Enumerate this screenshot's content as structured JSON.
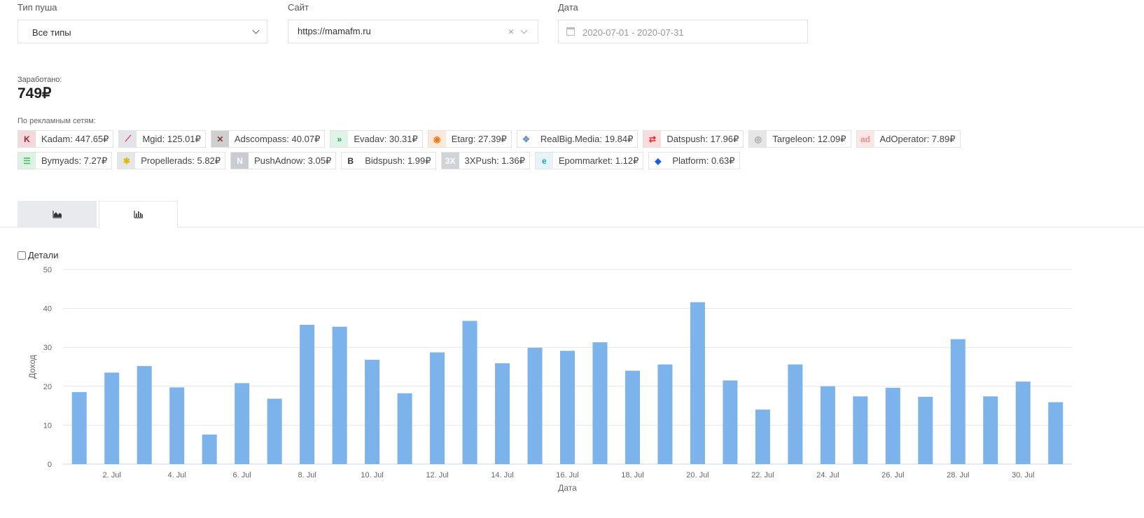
{
  "filters": {
    "push_type": {
      "label": "Тип пуша",
      "value": "Все типы"
    },
    "site": {
      "label": "Сайт",
      "value": "https://mamafm.ru",
      "clear": "×"
    },
    "date": {
      "label": "Дата",
      "placeholder": "2020-07-01 - 2020-07-31"
    }
  },
  "earned": {
    "label": "Заработано:",
    "value": "749₽"
  },
  "networks": {
    "label": "По рекламным сетям:",
    "items": [
      {
        "text": "Kadam: 447.65₽",
        "icon": "K",
        "color": "#b31b34",
        "bg": "#f3d9dd"
      },
      {
        "text": "Mgid: 125.01₽",
        "icon": "⟋",
        "color": "#e8242e",
        "bg": "#e3e3ec"
      },
      {
        "text": "Adscompass: 40.07₽",
        "icon": "✕",
        "color": "#7a3a3a",
        "bg": "#cfcfcf"
      },
      {
        "text": "Evadav: 30.31₽",
        "icon": "»",
        "color": "#1d9a55",
        "bg": "#dff3e7"
      },
      {
        "text": "Etarg: 27.39₽",
        "icon": "◉",
        "color": "#f07a1a",
        "bg": "#fde9da"
      },
      {
        "text": "RealBig.Media: 19.84₽",
        "icon": "✥",
        "color": "#6a8fbd",
        "bg": "#ffffff"
      },
      {
        "text": "Datspush: 17.96₽",
        "icon": "⇄",
        "color": "#e8242e",
        "bg": "#fbdcdc"
      },
      {
        "text": "Targeleon: 12.09₽",
        "icon": "◎",
        "color": "#a0a0a0",
        "bg": "#e6e6e6"
      },
      {
        "text": "AdOperator: 7.89₽",
        "icon": "ad",
        "color": "#f08c8c",
        "bg": "#fde6e6"
      },
      {
        "text": "Bymyads: 7.27₽",
        "icon": "☰",
        "color": "#4cbb6a",
        "bg": "#dcf2e2"
      },
      {
        "text": "Propellerads: 5.82₽",
        "icon": "✱",
        "color": "#e0b800",
        "bg": "#e6e6e6"
      },
      {
        "text": "PushAdnow: 3.05₽",
        "icon": "N",
        "color": "#ffffff",
        "bg": "#c9cdd3"
      },
      {
        "text": "Bidspush: 1.99₽",
        "icon": "B",
        "color": "#333333",
        "bg": "#ffffff"
      },
      {
        "text": "3XPush: 1.36₽",
        "icon": "3X",
        "color": "#ffffff",
        "bg": "#d0d3d8"
      },
      {
        "text": "Epommarket: 1.12₽",
        "icon": "e",
        "color": "#1aa3c9",
        "bg": "#e6f4fa"
      },
      {
        "text": "Platform: 0.63₽",
        "icon": "◆",
        "color": "#1a5fe0",
        "bg": "#ffffff"
      }
    ]
  },
  "tabs": [
    {
      "icon": "area-chart-icon",
      "active": false
    },
    {
      "icon": "bar-chart-icon",
      "active": true
    }
  ],
  "details_label": "Детали",
  "chart_data": {
    "type": "bar",
    "xlabel": "Дата",
    "ylabel": "Доход",
    "ylim": [
      0,
      50
    ],
    "yticks": [
      0,
      10,
      20,
      30,
      40,
      50
    ],
    "bar_color": "#7cb3ea",
    "grid": true,
    "categories": [
      "1. Jul",
      "2. Jul",
      "3. Jul",
      "4. Jul",
      "5. Jul",
      "6. Jul",
      "7. Jul",
      "8. Jul",
      "9. Jul",
      "10. Jul",
      "11. Jul",
      "12. Jul",
      "13. Jul",
      "14. Jul",
      "15. Jul",
      "16. Jul",
      "17. Jul",
      "18. Jul",
      "19. Jul",
      "20. Jul",
      "21. Jul",
      "22. Jul",
      "23. Jul",
      "24. Jul",
      "25. Jul",
      "26. Jul",
      "27. Jul",
      "28. Jul",
      "29. Jul",
      "30. Jul",
      "31. Jul"
    ],
    "tick_labels": [
      "2. Jul",
      "4. Jul",
      "6. Jul",
      "8. Jul",
      "10. Jul",
      "12. Jul",
      "14. Jul",
      "16. Jul",
      "18. Jul",
      "20. Jul",
      "22. Jul",
      "24. Jul",
      "26. Jul",
      "28. Jul",
      "30. Jul"
    ],
    "values": [
      18.5,
      23.5,
      25.2,
      19.7,
      7.6,
      20.8,
      16.8,
      35.8,
      35.3,
      26.8,
      18.2,
      28.7,
      36.8,
      25.9,
      29.9,
      29.1,
      31.3,
      24.0,
      25.6,
      41.6,
      21.5,
      14.0,
      25.6,
      20.0,
      17.4,
      19.6,
      17.3,
      32.1,
      17.4,
      21.2,
      15.9
    ]
  }
}
